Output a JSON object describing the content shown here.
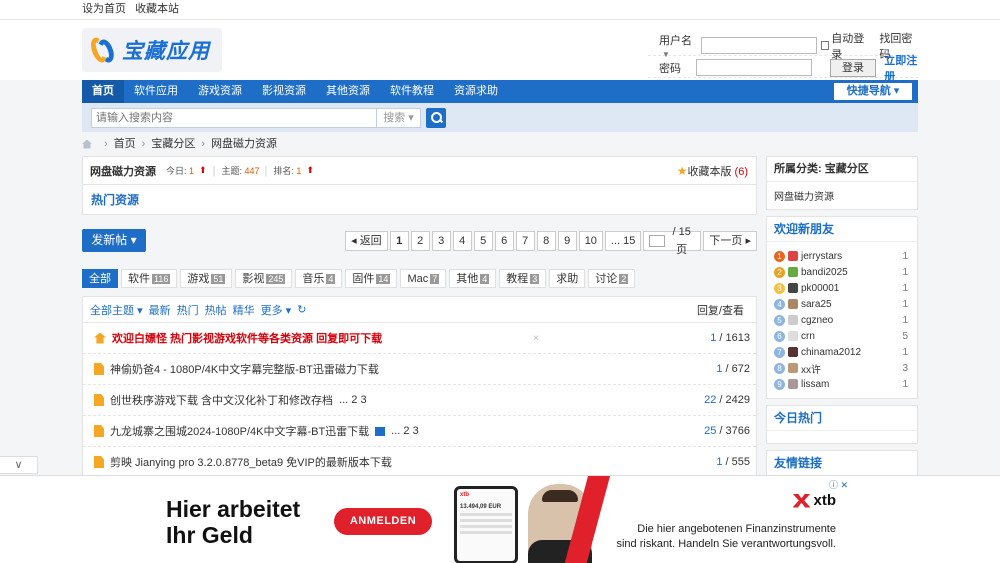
{
  "topbar": {
    "set_home": "设为首页",
    "bookmark": "收藏本站"
  },
  "logo": {
    "text": "宝藏应用"
  },
  "login": {
    "username_label": "用户名",
    "password_label": "密码",
    "auto_login": "自动登录",
    "forgot": "找回密码",
    "login_btn": "登录",
    "register": "立即注册"
  },
  "nav": {
    "items": [
      "首页",
      "软件应用",
      "游戏资源",
      "影视资源",
      "其他资源",
      "软件教程",
      "资源求助"
    ],
    "quick": "快捷导航"
  },
  "search": {
    "placeholder": "请输入搜索内容",
    "select": "搜索"
  },
  "breadcrumb": [
    "首页",
    "宝藏分区",
    "网盘磁力资源"
  ],
  "forum": {
    "name": "网盘磁力资源",
    "today_label": "今日:",
    "today": "1",
    "topics_label": "主题:",
    "topics": "447",
    "rank_label": "排名:",
    "rank": "1",
    "favorite": "收藏本版",
    "favorite_count": "(6)"
  },
  "hot_resources": "热门资源",
  "post_button": "发新帖",
  "pager": {
    "back": "返回",
    "pages": [
      "1",
      "2",
      "3",
      "4",
      "5",
      "6",
      "7",
      "8",
      "9",
      "10",
      "... 15"
    ],
    "current_input": "1",
    "total": "/ 15 页",
    "next": "下一页"
  },
  "types": [
    {
      "label": "全部",
      "count": ""
    },
    {
      "label": "软件",
      "count": "116"
    },
    {
      "label": "游戏",
      "count": "51"
    },
    {
      "label": "影视",
      "count": "245"
    },
    {
      "label": "音乐",
      "count": "4"
    },
    {
      "label": "固件",
      "count": "14"
    },
    {
      "label": "Mac",
      "count": "7"
    },
    {
      "label": "其他",
      "count": "4"
    },
    {
      "label": "教程",
      "count": "3"
    },
    {
      "label": "求助",
      "count": ""
    },
    {
      "label": "讨论",
      "count": "2"
    }
  ],
  "filters": {
    "all": "全部主题",
    "latest": "最新",
    "hot": "热门",
    "hot_posts": "热帖",
    "digest": "精华",
    "more": "更多",
    "reply_view": "回复/查看"
  },
  "threads": [
    {
      "title": "欢迎白嫖怪 热门影视游戏软件等各类资源 回复即可下载",
      "pages": "",
      "replies": "1",
      "views": "1613"
    },
    {
      "title": "神偷奶爸4 - 1080P/4K中文字幕完整版-BT迅雷磁力下载",
      "pages": "",
      "replies": "1",
      "views": "672"
    },
    {
      "title": "创世秩序游戏下载 含中文汉化补丁和修改存档",
      "pages": "... 2  3",
      "replies": "22",
      "views": "2429"
    },
    {
      "title": "九龙城寨之围城2024-1080P/4K中文字幕-BT迅雷下载",
      "pages": "... 2  3",
      "replies": "25",
      "views": "3766"
    },
    {
      "title": "剪映 Jianying pro 3.2.0.8778_beta9 免VIP的最新版本下载",
      "pages": "",
      "replies": "1",
      "views": "555"
    }
  ],
  "sidebar": {
    "category_title": "所属分类: 宝藏分区",
    "category_item": "网盘磁力资源",
    "welcome_title": "欢迎新朋友",
    "friends": [
      {
        "rank": "1",
        "name": "jerrystars",
        "value": "1"
      },
      {
        "rank": "2",
        "name": "bandi2025",
        "value": "1"
      },
      {
        "rank": "3",
        "name": "pk00001",
        "value": "1"
      },
      {
        "rank": "4",
        "name": "sara25",
        "value": "1"
      },
      {
        "rank": "5",
        "name": "cgzneo",
        "value": "1"
      },
      {
        "rank": "6",
        "name": "crn",
        "value": "5"
      },
      {
        "rank": "7",
        "name": "chinama2012",
        "value": "1"
      },
      {
        "rank": "8",
        "name": "xx许",
        "value": "3"
      },
      {
        "rank": "9",
        "name": "lissam",
        "value": "1"
      }
    ],
    "today_hot": "今日热门",
    "links": "友情链接"
  },
  "ad": {
    "headline_1": "Hier arbeitet",
    "headline_2": "Ihr Geld",
    "cta": "ANMELDEN",
    "phone_brand": "xtb",
    "phone_value": "13.494,09 EUR",
    "brand": "xtb",
    "disclaimer": "Die hier angebotenen Finanzinstrumente sind riskant. Handeln Sie verantwortungsvoll."
  },
  "colors": {
    "primary": "#1e6ec7",
    "accent": "#d9000a",
    "orange": "#f5a623"
  }
}
